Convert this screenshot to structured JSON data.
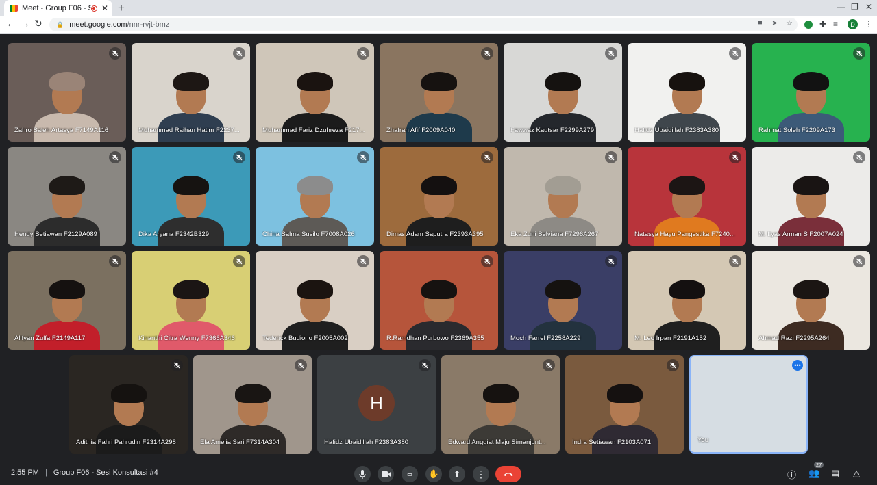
{
  "browser": {
    "tab_title": "Meet - Group F06 - Ses",
    "new_tab": "+",
    "url_host": "meet.google.com",
    "url_path": "/nnr-rvjt-bmz",
    "profile_initial": "D"
  },
  "participants": [
    {
      "name": "Zahro Saleh Artasya F7149A116",
      "bg": "#6a5d58",
      "shirt": "#c8b9ad",
      "hair": "#9a8477"
    },
    {
      "name": "Muhammad Raihan Hatim F2237...",
      "bg": "#d9d4cc",
      "shirt": "#2f3e50",
      "hair": "#1d1714"
    },
    {
      "name": "Muhammad Fariz Dzuhreza F217...",
      "bg": "#cfc6b9",
      "shirt": "#1b1b1b",
      "hair": "#1a1310"
    },
    {
      "name": "Zhafran Afif F2009A040",
      "bg": "#8a7560",
      "shirt": "#1e3a4b",
      "hair": "#161210"
    },
    {
      "name": "Fawwaz Kautsar F2299A279",
      "bg": "#d8d8d6",
      "shirt": "#24272c",
      "hair": "#151210"
    },
    {
      "name": "Hafidz Ubaidillah F2383A380",
      "bg": "#f1f1ef",
      "shirt": "#3f464c",
      "hair": "#17120f"
    },
    {
      "name": "Rahmat Soleh F2209A173",
      "bg": "#27b24f",
      "shirt": "#3c5a78",
      "hair": "#121212"
    },
    {
      "name": "Hendy Setiawan F2129A089",
      "bg": "#8a8782",
      "shirt": "#2c2c2c",
      "hair": "#1e1a17"
    },
    {
      "name": "Dika Aryana F2342B329",
      "bg": "#3c9ab8",
      "shirt": "#2e2e2e",
      "hair": "#161311"
    },
    {
      "name": "China Salma Susilo F7008A026",
      "bg": "#7dc1e0",
      "shirt": "#5d5a56",
      "hair": "#8c8c8c"
    },
    {
      "name": "Dimas Adam Saputra F2393A395",
      "bg": "#9d6b3d",
      "shirt": "#1e1e1e",
      "hair": "#141010"
    },
    {
      "name": "Eka Zuni Selviana F7296A267",
      "bg": "#c0b8ad",
      "shirt": "#8d8a85",
      "hair": "#a29d93"
    },
    {
      "name": "Natasya Hayu Pangestika F7240...",
      "bg": "#b8343b",
      "shirt": "#e07a1f",
      "hair": "#1c1514"
    },
    {
      "name": "M. Ilyas Arman S F2007A024",
      "bg": "#ecebe9",
      "shirt": "#7a2f3a",
      "hair": "#191413"
    },
    {
      "name": "Alifyan Zulfa F2149A117",
      "bg": "#7b7060",
      "shirt": "#c21f2a",
      "hair": "#151110"
    },
    {
      "name": "Kinanthi Citra Wenny F7366A346",
      "bg": "#d8cf74",
      "shirt": "#e05a6a",
      "hair": "#1b1514"
    },
    {
      "name": "Tederick Budiono F2005A002",
      "bg": "#d9cfc4",
      "shirt": "#1f1f1f",
      "hair": "#1b1410"
    },
    {
      "name": "R.Ramdhan Purbowo F2369A355",
      "bg": "#b6553b",
      "shirt": "#2a2a2e",
      "hair": "#161210"
    },
    {
      "name": "Moch Farrel F2258A229",
      "bg": "#3a3e66",
      "shirt": "#23323e",
      "hair": "#151210"
    },
    {
      "name": "M. Leo Irpan F2191A152",
      "bg": "#d4c8b4",
      "shirt": "#1f1f1f",
      "hair": "#141010"
    },
    {
      "name": "Ahmad Razi F2295A264",
      "bg": "#ebe7e0",
      "shirt": "#3d2b22",
      "hair": "#1b1513"
    },
    {
      "name": "Adithia Fahri Pahrudin F2314A298",
      "bg": "#2a2622",
      "shirt": "#1b1b1b",
      "hair": "#151210"
    },
    {
      "name": "Ela Amelia Sari F7314A304",
      "bg": "#a0968c",
      "shirt": "#2e2a28",
      "hair": "#191513"
    },
    {
      "name": "Hafidz Ubaidillah F2383A380",
      "bg": "#3c4043",
      "avatar": "H"
    },
    {
      "name": "Edward Anggiat Maju Simanjunt...",
      "bg": "#8a7a68",
      "shirt": "#3c3a36",
      "hair": "#161210"
    },
    {
      "name": "Indra Setiawan F2103A071",
      "bg": "#7a5a3e",
      "shirt": "#2f2a33",
      "hair": "#151110"
    },
    {
      "name": "You",
      "bg": "#d6dde3",
      "shirt": "#7fa6d4",
      "hair": "#1c1613",
      "self": true
    }
  ],
  "bottom": {
    "time": "2:55 PM",
    "separator": "|",
    "meeting_name": "Group F06 - Sesi Konsultasi #4",
    "participants_count": "27"
  }
}
